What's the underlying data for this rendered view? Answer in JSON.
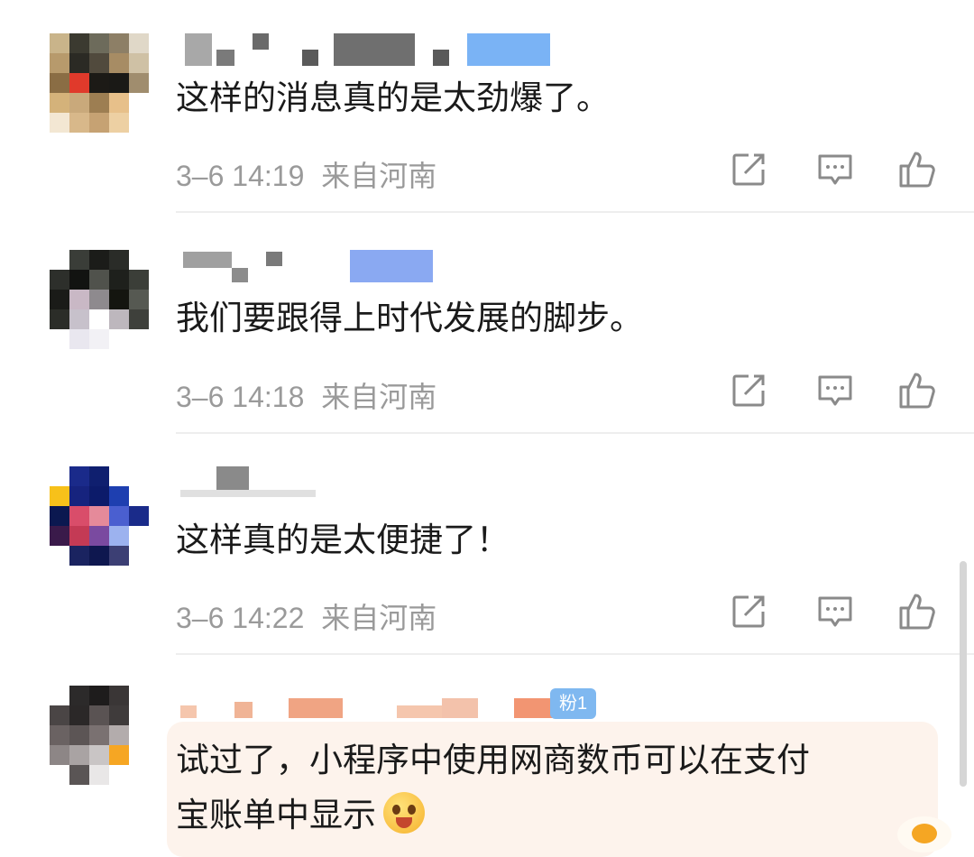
{
  "comments": [
    {
      "content": "这样的消息真的是太劲爆了。",
      "time": "3–6 14:19",
      "location": "来自河南",
      "avatar_colors": [
        "#c9b48a",
        "#3b3a30",
        "#6d6b5b",
        "#8d7f66",
        "#e0d8c8",
        "#b79a6c",
        "#2b2a24",
        "#514a3d",
        "#a78c64",
        "#cfc1a5",
        "#8a6d44",
        "#e03a2b",
        "#1c1a16",
        "#1a1916",
        "#a08d6e",
        "#d4b27a",
        "#c9a97b",
        "#9d7e52",
        "#e7c08a",
        "#ffffff",
        "#f3e7d3",
        "#d8b88a",
        "#c6a273",
        "#edd0a3",
        "#ffffff"
      ],
      "name_colors": [
        "#9a9a9a",
        "#5a5a5a",
        "#6f6f6f",
        "#7ab3f5"
      ]
    },
    {
      "content": "我们要跟得上时代发展的脚步。",
      "time": "3–6 14:18",
      "location": "来自河南",
      "avatar_colors": [
        "#ffffff",
        "#3a3d38",
        "#1b1c19",
        "#2a2c28",
        "#ffffff",
        "#2d2f2b",
        "#121311",
        "#50524c",
        "#1e201c",
        "#3b3e38",
        "#1a1b18",
        "#c9b8c5",
        "#8e8a8e",
        "#14150f",
        "#565952",
        "#2b2d28",
        "#c7c1cb",
        "#ffffff",
        "#bdb7bd",
        "#3e403b",
        "#ffffff",
        "#e9e7ef",
        "#f2f1f5",
        "#ffffff",
        "#ffffff"
      ],
      "name_colors": [
        "#a0a0a0",
        "#7a7a7a",
        "#8aa9f2"
      ]
    },
    {
      "content": "这样真的是太便捷了！",
      "time": "3–6 14:22",
      "location": "来自河南",
      "avatar_colors": [
        "#ffffff",
        "#1a2a8a",
        "#0f1f6f",
        "#ffffff",
        "#ffffff",
        "#f7c11a",
        "#16237e",
        "#0c1b6a",
        "#1e3fb0",
        "#ffffff",
        "#0b1850",
        "#d94d6a",
        "#e58a9a",
        "#4a5fd0",
        "#1a2b8a",
        "#3a1a4a",
        "#c43a55",
        "#7a4aa0",
        "#9cb2ef",
        "#ffffff",
        "#ffffff",
        "#1a2360",
        "#0e174f",
        "#3c3f74",
        "#ffffff"
      ],
      "name_colors": [
        "#8a8a8a",
        "#b0b0b0"
      ]
    },
    {
      "content_line1": "试过了，小程序中使用网商数币可以在支付",
      "content_line2": "宝账单中显示",
      "avatar_colors": [
        "#ffffff",
        "#2c2a2a",
        "#1e1c1c",
        "#3a3636",
        "#ffffff",
        "#4a4545",
        "#2b2828",
        "#5a5353",
        "#3f3b3b",
        "#ffffff",
        "#6a6262",
        "#5c5555",
        "#7a7171",
        "#b3acac",
        "#ffffff",
        "#8d8686",
        "#a9a3a3",
        "#c9c5c5",
        "#f6a623",
        "#ffffff",
        "#ffffff",
        "#5a5555",
        "#e9e7e7",
        "#ffffff",
        "#ffffff"
      ],
      "name_colors": [
        "#f0b496",
        "#f0a483",
        "#f3c2ab",
        "#f29572"
      ],
      "badge_text": "粉1"
    }
  ],
  "icons": {
    "share": "share-icon",
    "reply": "comment-icon",
    "like": "thumbs-up-icon"
  }
}
